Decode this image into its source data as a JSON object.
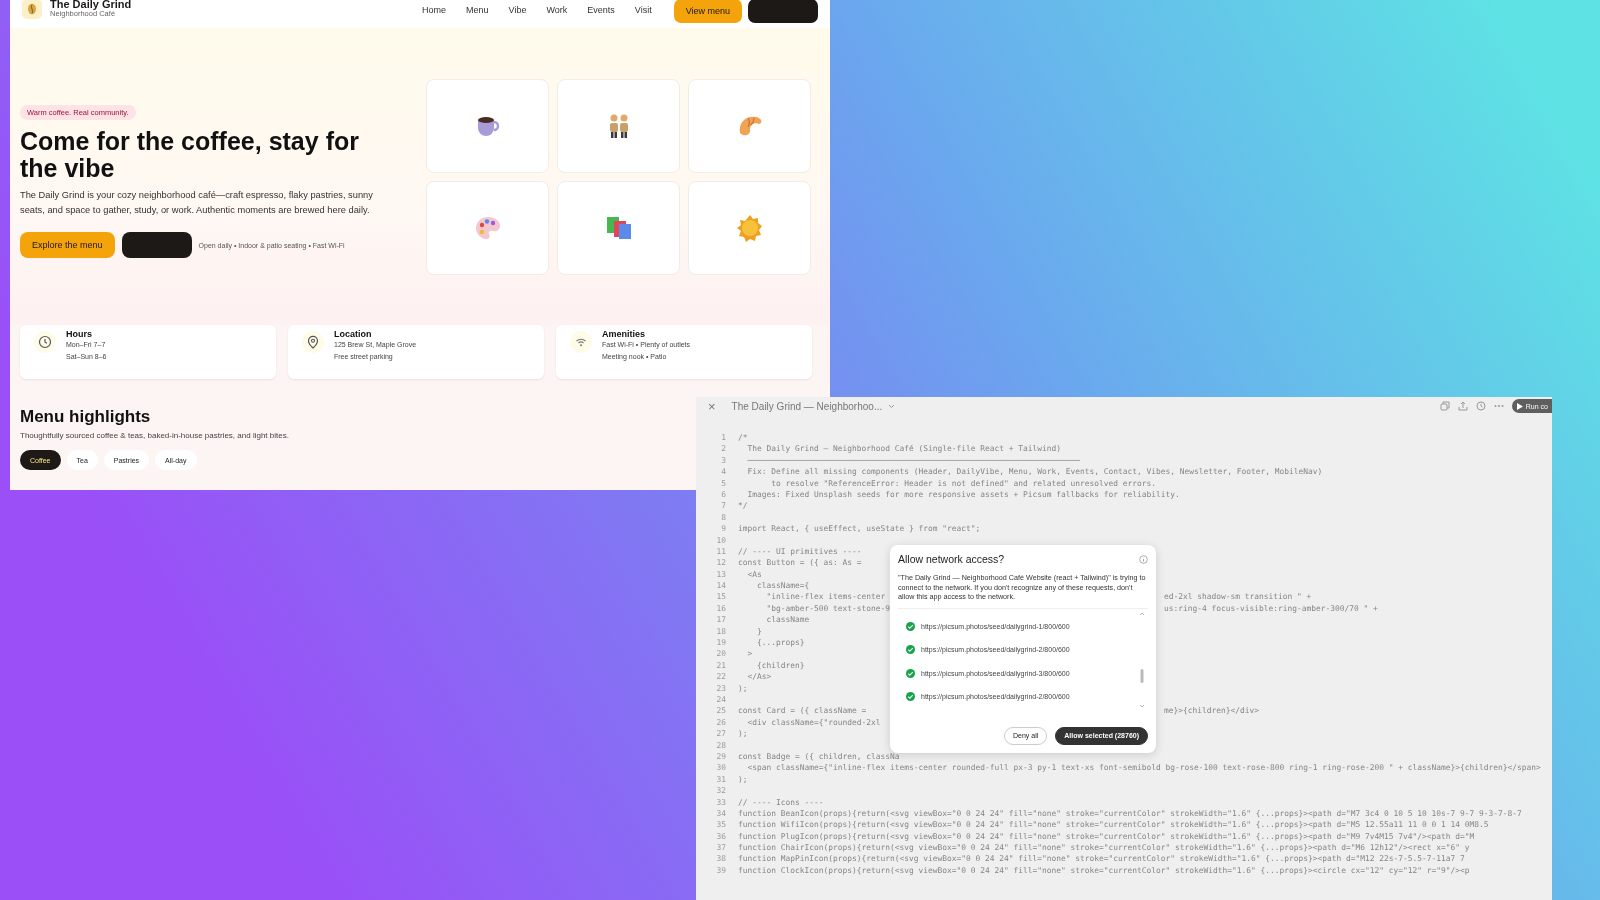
{
  "site": {
    "brand": "The Daily Grind",
    "subtitle": "Neighborhood Café",
    "nav": [
      "Home",
      "Menu",
      "Vibe",
      "Work",
      "Events",
      "Visit"
    ],
    "header_buttons": [
      {
        "kind": "primary",
        "label": "View menu"
      },
      {
        "kind": "dark"
      }
    ],
    "hero": {
      "badge": "Warm coffee. Real community.",
      "title": "Come for the coffee, stay for the vibe",
      "body": "The Daily Grind is your cozy neighborhood café—craft espresso, flaky pastries, sunny seats, and space to gather, study, or work. Authentic moments are brewed here daily.",
      "buttons": [
        {
          "kind": "primary",
          "label": "Explore the menu"
        },
        {
          "kind": "dark"
        }
      ],
      "note": "Open daily • Indoor & patio seating • Fast Wi‑Fi",
      "tiles": [
        {
          "kind": "coffee"
        },
        {
          "kind": "people"
        },
        {
          "kind": "croissant"
        },
        {
          "kind": "palette"
        },
        {
          "kind": "squares"
        },
        {
          "kind": "sun"
        }
      ]
    },
    "info_cards": [
      {
        "kind": "clock",
        "title": "Hours",
        "lines": [
          "Mon–Fri 7–7",
          "Sat–Sun 8–6"
        ]
      },
      {
        "kind": "pin",
        "title": "Location",
        "lines": [
          "125 Brew St, Maple Grove",
          "Free street parking"
        ]
      },
      {
        "kind": "wifi",
        "title": "Amenities",
        "lines": [
          "Fast Wi‑Fi • Plenty of outlets",
          "Meeting nook • Patio"
        ]
      }
    ],
    "menu": {
      "title": "Menu highlights",
      "subtitle": "Thoughtfully sourced coffee & teas, baked-in-house pastries, and light bites.",
      "chips": [
        {
          "label": "Coffee",
          "selected": true
        },
        {
          "label": "Tea",
          "selected": false
        },
        {
          "label": "Pastries",
          "selected": false
        },
        {
          "label": "All-day",
          "selected": false
        }
      ]
    }
  },
  "editor": {
    "close": "×",
    "title": "The Daily Grind — Neighborhoo...",
    "run": "Run co",
    "code": [
      {
        "n": "1",
        "text": "/*"
      },
      {
        "n": "2",
        "text": "  The Daily Grind — Neighborhood Café (Single-file React + Tailwind)"
      },
      {
        "n": "3",
        "text": "  ──────────────────────────────────────────────────────────────────────"
      },
      {
        "n": "4",
        "text": "  Fix: Define all missing components (Header, DailyVibe, Menu, Work, Events, Contact, Vibes, Newsletter, Footer, MobileNav)"
      },
      {
        "n": "5",
        "text": "       to resolve \"ReferenceError: Header is not defined\" and related unresolved errors."
      },
      {
        "n": "6",
        "text": "  Images: Fixed Unsplash seeds for more responsive assets + Picsum fallbacks for reliability."
      },
      {
        "n": "7",
        "text": "*/"
      },
      {
        "n": "8"
      },
      {
        "n": "9",
        "text": "import React, { useEffect, useState } from \"react\";"
      },
      {
        "n": "10"
      },
      {
        "n": "11",
        "text": "// ---- UI primitives ----"
      },
      {
        "n": "12",
        "text": "const Button = ({ as: As ="
      },
      {
        "n": "13",
        "text": "  <As"
      },
      {
        "n": "14",
        "text": "    className={"
      },
      {
        "n": "15",
        "text": "      \"inline-flex items-center ",
        "tail": "ed-2xl shadow-sm transition \" +"
      },
      {
        "n": "16",
        "text": "      \"bg-amber-500 text-stone-9",
        "tail": "us:ring-4 focus-visible:ring-amber-300/70 \" +"
      },
      {
        "n": "17",
        "text": "      className"
      },
      {
        "n": "18",
        "text": "    }"
      },
      {
        "n": "19",
        "text": "    {...props}"
      },
      {
        "n": "20",
        "text": "  >"
      },
      {
        "n": "21",
        "text": "    {children}"
      },
      {
        "n": "22",
        "text": "  </As>"
      },
      {
        "n": "23",
        "text": ");"
      },
      {
        "n": "24"
      },
      {
        "n": "25",
        "text": "const Card = ({ className =",
        "tail": "me}>{children}</div>"
      },
      {
        "n": "26",
        "text": "  <div className={\"rounded-2xl"
      },
      {
        "n": "27",
        "text": ");"
      },
      {
        "n": "28"
      },
      {
        "n": "29",
        "text": "const Badge = ({ children, classNa"
      },
      {
        "n": "30",
        "text": "  <span className={\"inline-flex items-center rounded-full px-3 py-1 text-xs font-semibold bg-rose-100 text-rose-800 ring-1 ring-rose-200 \" + className}>{children}</span>"
      },
      {
        "n": "31",
        "text": ");"
      },
      {
        "n": "32"
      },
      {
        "n": "33",
        "text": "// ---- Icons ----"
      },
      {
        "n": "34",
        "text": "function BeanIcon(props){return(<svg viewBox=\"0 0 24 24\" fill=\"none\" stroke=\"currentColor\" strokeWidth=\"1.6\" {...props}><path d=\"M7 3c4 0 10 5 10 10s-7 9-7 9-3-7-8-7"
      },
      {
        "n": "35",
        "text": "function WifiIcon(props){return(<svg viewBox=\"0 0 24 24\" fill=\"none\" stroke=\"currentColor\" strokeWidth=\"1.6\" {...props}><path d=\"M5 12.55a11 11 0 0 1 14 0M8.5"
      },
      {
        "n": "36",
        "text": "function PlugIcon(props){return(<svg viewBox=\"0 0 24 24\" fill=\"none\" stroke=\"currentColor\" strokeWidth=\"1.6\" {...props}><path d=\"M9 7v4M15 7v4\"/><path d=\"M"
      },
      {
        "n": "37",
        "text": "function ChairIcon(props){return(<svg viewBox=\"0 0 24 24\" fill=\"none\" stroke=\"currentColor\" strokeWidth=\"1.6\" {...props}><path d=\"M6 12h12\"/><rect x=\"6\" y"
      },
      {
        "n": "38",
        "text": "function MapPinIcon(props){return(<svg viewBox=\"0 0 24 24\" fill=\"none\" stroke=\"currentColor\" strokeWidth=\"1.6\" {...props}><path d=\"M12 22s-7-5.5-7-11a7 7"
      },
      {
        "n": "39",
        "text": "function ClockIcon(props){return(<svg viewBox=\"0 0 24 24\" fill=\"none\" stroke=\"currentColor\" strokeWidth=\"1.6\" {...props}><circle cx=\"12\" cy=\"12\" r=\"9\"/><p"
      }
    ],
    "dialog": {
      "title": "Allow network access?",
      "message": "\"The Daily Grind — Neighborhood Café Website (react + Tailwind)\" is trying to connect to the network. If you don't recognize any of these requests, don't allow this app access to the network.",
      "requests": [
        {
          "url": "https://picsum.photos/seed/dailygrind-1/800/600",
          "checked": true
        },
        {
          "url": "https://picsum.photos/seed/dailygrind-2/800/600",
          "checked": true
        },
        {
          "url": "https://picsum.photos/seed/dailygrind-3/800/600",
          "checked": true
        },
        {
          "url": "https://picsum.photos/seed/dailygrind-2/800/600",
          "checked": true
        }
      ],
      "buttons": [
        {
          "kind": "secondary",
          "label": "Deny all"
        },
        {
          "kind": "primary",
          "label": "Allow selected (28760)"
        }
      ]
    }
  }
}
